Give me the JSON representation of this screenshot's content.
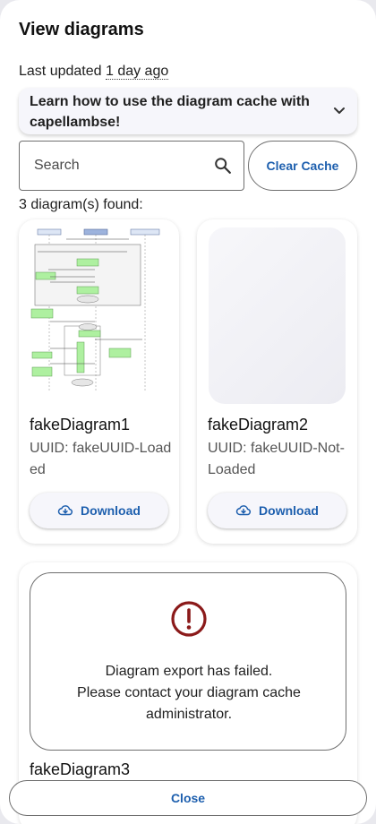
{
  "dialog": {
    "title": "View diagrams",
    "updated_prefix": "Last updated ",
    "updated_ago": "1 day ago",
    "accordion_label": "Learn how to use the diagram cache with capellambse!",
    "search_placeholder": "Search",
    "clear_cache_label": "Clear Cache",
    "found_text": "3 diagram(s) found:",
    "close_label": "Close"
  },
  "diagrams": [
    {
      "name": "fakeDiagram1",
      "uuid": "UUID: fakeUUID-Loaded",
      "download_label": "Download",
      "state": "loaded"
    },
    {
      "name": "fakeDiagram2",
      "uuid": "UUID: fakeUUID-Not-Loaded",
      "download_label": "Download",
      "state": "loading"
    },
    {
      "name": "fakeDiagram3",
      "state": "error",
      "error_line1": "Diagram export has failed.",
      "error_line2": "Please contact your diagram cache administrator."
    }
  ],
  "colors": {
    "accent": "#1d5fae",
    "error": "#8b1a1a",
    "surface": "#f6f6fb"
  },
  "icons": {
    "accordion": "chevron-down-icon",
    "search": "search-icon",
    "download": "cloud-download-icon",
    "error": "error-circle-icon"
  }
}
